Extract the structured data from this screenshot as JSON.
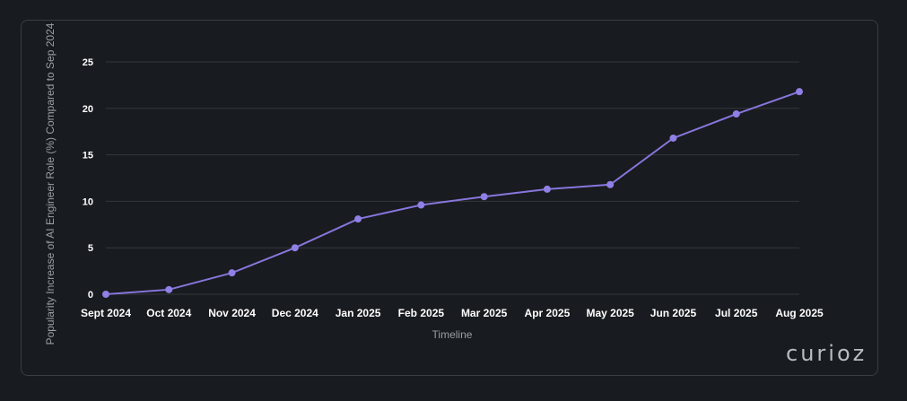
{
  "brand": {
    "name": "curioz"
  },
  "colors": {
    "line": "#8676dc",
    "point": "#8f7fe6",
    "grid": "#33373c",
    "background": "#181b1f"
  },
  "chart_data": {
    "type": "line",
    "title": "",
    "xlabel": "Timeline",
    "ylabel": "Popularity Increase of AI Engineer Role (%) Compared to Sep 2024",
    "ylim": [
      0,
      25
    ],
    "yticks": [
      0,
      5,
      10,
      15,
      20,
      25
    ],
    "grid": true,
    "categories": [
      "Sept 2024",
      "Oct 2024",
      "Nov 2024",
      "Dec 2024",
      "Jan 2025",
      "Feb 2025",
      "Mar 2025",
      "Apr 2025",
      "May 2025",
      "Jun 2025",
      "Jul 2025",
      "Aug 2025"
    ],
    "series": [
      {
        "values": [
          0,
          0.5,
          2.3,
          5.0,
          8.1,
          9.6,
          10.5,
          11.3,
          11.8,
          16.8,
          19.4,
          21.8
        ]
      }
    ]
  }
}
